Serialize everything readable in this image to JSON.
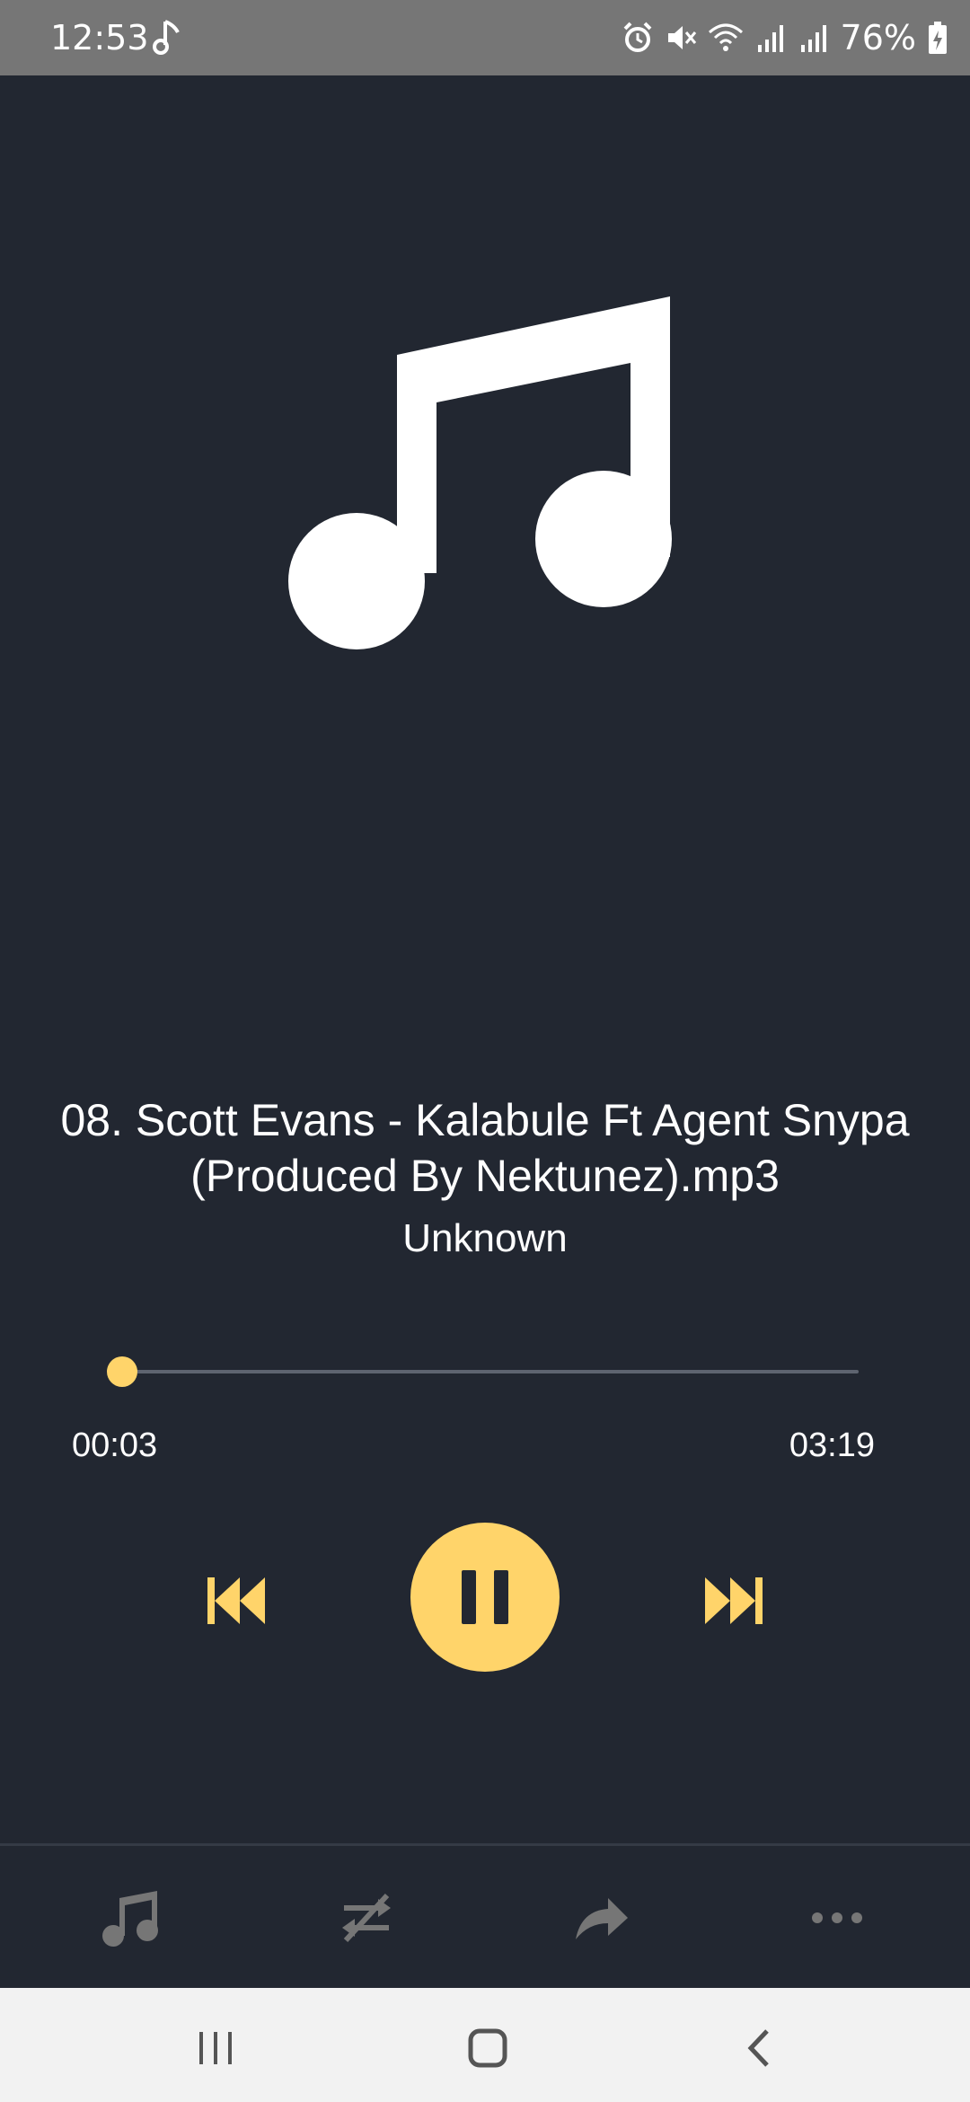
{
  "status_bar": {
    "time": "12:53",
    "battery": "76%",
    "icons": [
      "music-note-icon",
      "alarm-icon",
      "mute-icon",
      "wifi-icon",
      "signal-icon",
      "signal-icon",
      "battery-charging-icon"
    ]
  },
  "player": {
    "title": "08. Scott Evans - Kalabule Ft Agent Snypa (Produced By Nektunez).mp3",
    "artist": "Unknown",
    "elapsed": "00:03",
    "duration": "03:19",
    "progress": 0.0
  },
  "controls": {
    "previous": "skip-previous-icon",
    "play_pause": "pause-icon",
    "next": "skip-next-icon"
  },
  "toolbar": {
    "items": [
      "music-note-icon",
      "shuffle-off-icon",
      "share-icon",
      "more-icon"
    ]
  },
  "navbar": {
    "items": [
      "recents-icon",
      "home-icon",
      "back-icon"
    ]
  },
  "colors": {
    "background": "#222731",
    "accent": "#ffd46a",
    "status_bar": "#767676",
    "nav_bar": "#f2f2f2"
  }
}
